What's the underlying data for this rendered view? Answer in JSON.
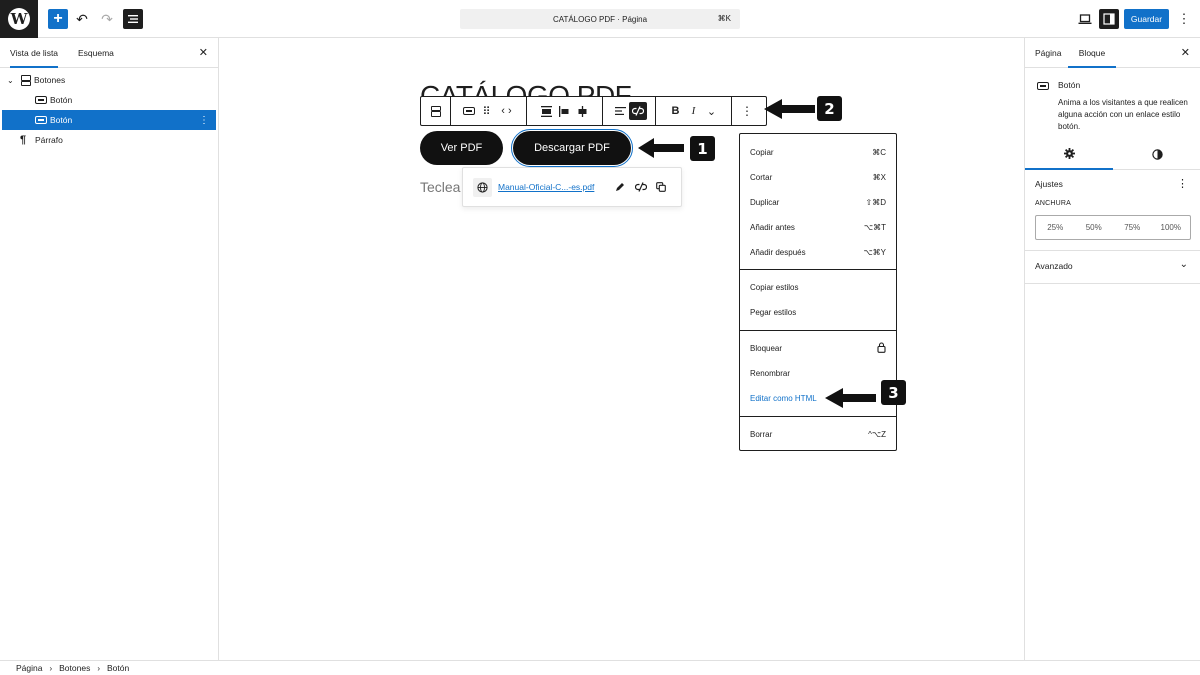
{
  "topbar": {
    "logo_glyph": "W",
    "add_glyph": "+",
    "undo_glyph": "↶",
    "redo_glyph": "↷",
    "doc_title": "CATÁLOGO PDF · Página",
    "doc_shortcut": "⌘K",
    "save_label": "Guardar",
    "options_glyph": "⋮"
  },
  "left_panel": {
    "tabs": [
      "Vista de lista",
      "Esquema"
    ],
    "close_glyph": "✕",
    "tree": [
      {
        "label": "Botones",
        "icon": "buttons-group-icon",
        "chevron": "⌄"
      },
      {
        "label": "Botón",
        "icon": "button-block-icon"
      },
      {
        "label": "Botón",
        "icon": "button-block-icon",
        "selected": true,
        "dots": "⋮"
      },
      {
        "label": "Párrafo",
        "icon": "paragraph-icon",
        "glyph": "¶"
      }
    ]
  },
  "canvas": {
    "heading": "CATÁLOGO PDF",
    "buttons": [
      "Ver PDF",
      "Descargar PDF"
    ],
    "paragraph_placeholder": "Teclea",
    "link_popover": {
      "link_text": "Manual-Oficial-C...-es.pdf",
      "globe_glyph": "⊕"
    },
    "toolbar": {
      "bold": "B",
      "italic": "I",
      "more": "⌄",
      "options": "⋮",
      "chevrons": "‹ ›",
      "drag": "⠿"
    }
  },
  "menu": {
    "items": [
      {
        "label": "Copiar",
        "shortcut": "⌘C"
      },
      {
        "label": "Cortar",
        "shortcut": "⌘X"
      },
      {
        "label": "Duplicar",
        "shortcut": "⇧⌘D"
      },
      {
        "label": "Añadir antes",
        "shortcut": "⌥⌘T"
      },
      {
        "label": "Añadir después",
        "shortcut": "⌥⌘Y"
      },
      {
        "label": "Copiar estilos",
        "shortcut": ""
      },
      {
        "label": "Pegar estilos",
        "shortcut": ""
      },
      {
        "label": "Bloquear",
        "shortcut": "🔒"
      },
      {
        "label": "Renombrar",
        "shortcut": ""
      },
      {
        "label": "Editar como HTML",
        "shortcut": ""
      },
      {
        "label": "Borrar",
        "shortcut": "^⌥Z"
      }
    ]
  },
  "annotations": [
    "1",
    "2",
    "3"
  ],
  "right_panel": {
    "tabs": [
      "Página",
      "Bloque"
    ],
    "close_glyph": "✕",
    "block_title": "Botón",
    "block_desc": "Anima a los visitantes a que realicen alguna acción con un enlace estilo botón.",
    "settings_label": "Ajustes",
    "settings_dots": "⋮",
    "width_label": "ANCHURA",
    "width_options": [
      "25%",
      "50%",
      "75%",
      "100%"
    ],
    "advanced_label": "Avanzado",
    "advanced_chev": "⌄"
  },
  "footer": {
    "breadcrumbs": [
      "Página",
      "Botones",
      "Botón"
    ],
    "separator": "›"
  },
  "colors": {
    "accent": "#1171c9",
    "dark": "#1e1e1e"
  }
}
